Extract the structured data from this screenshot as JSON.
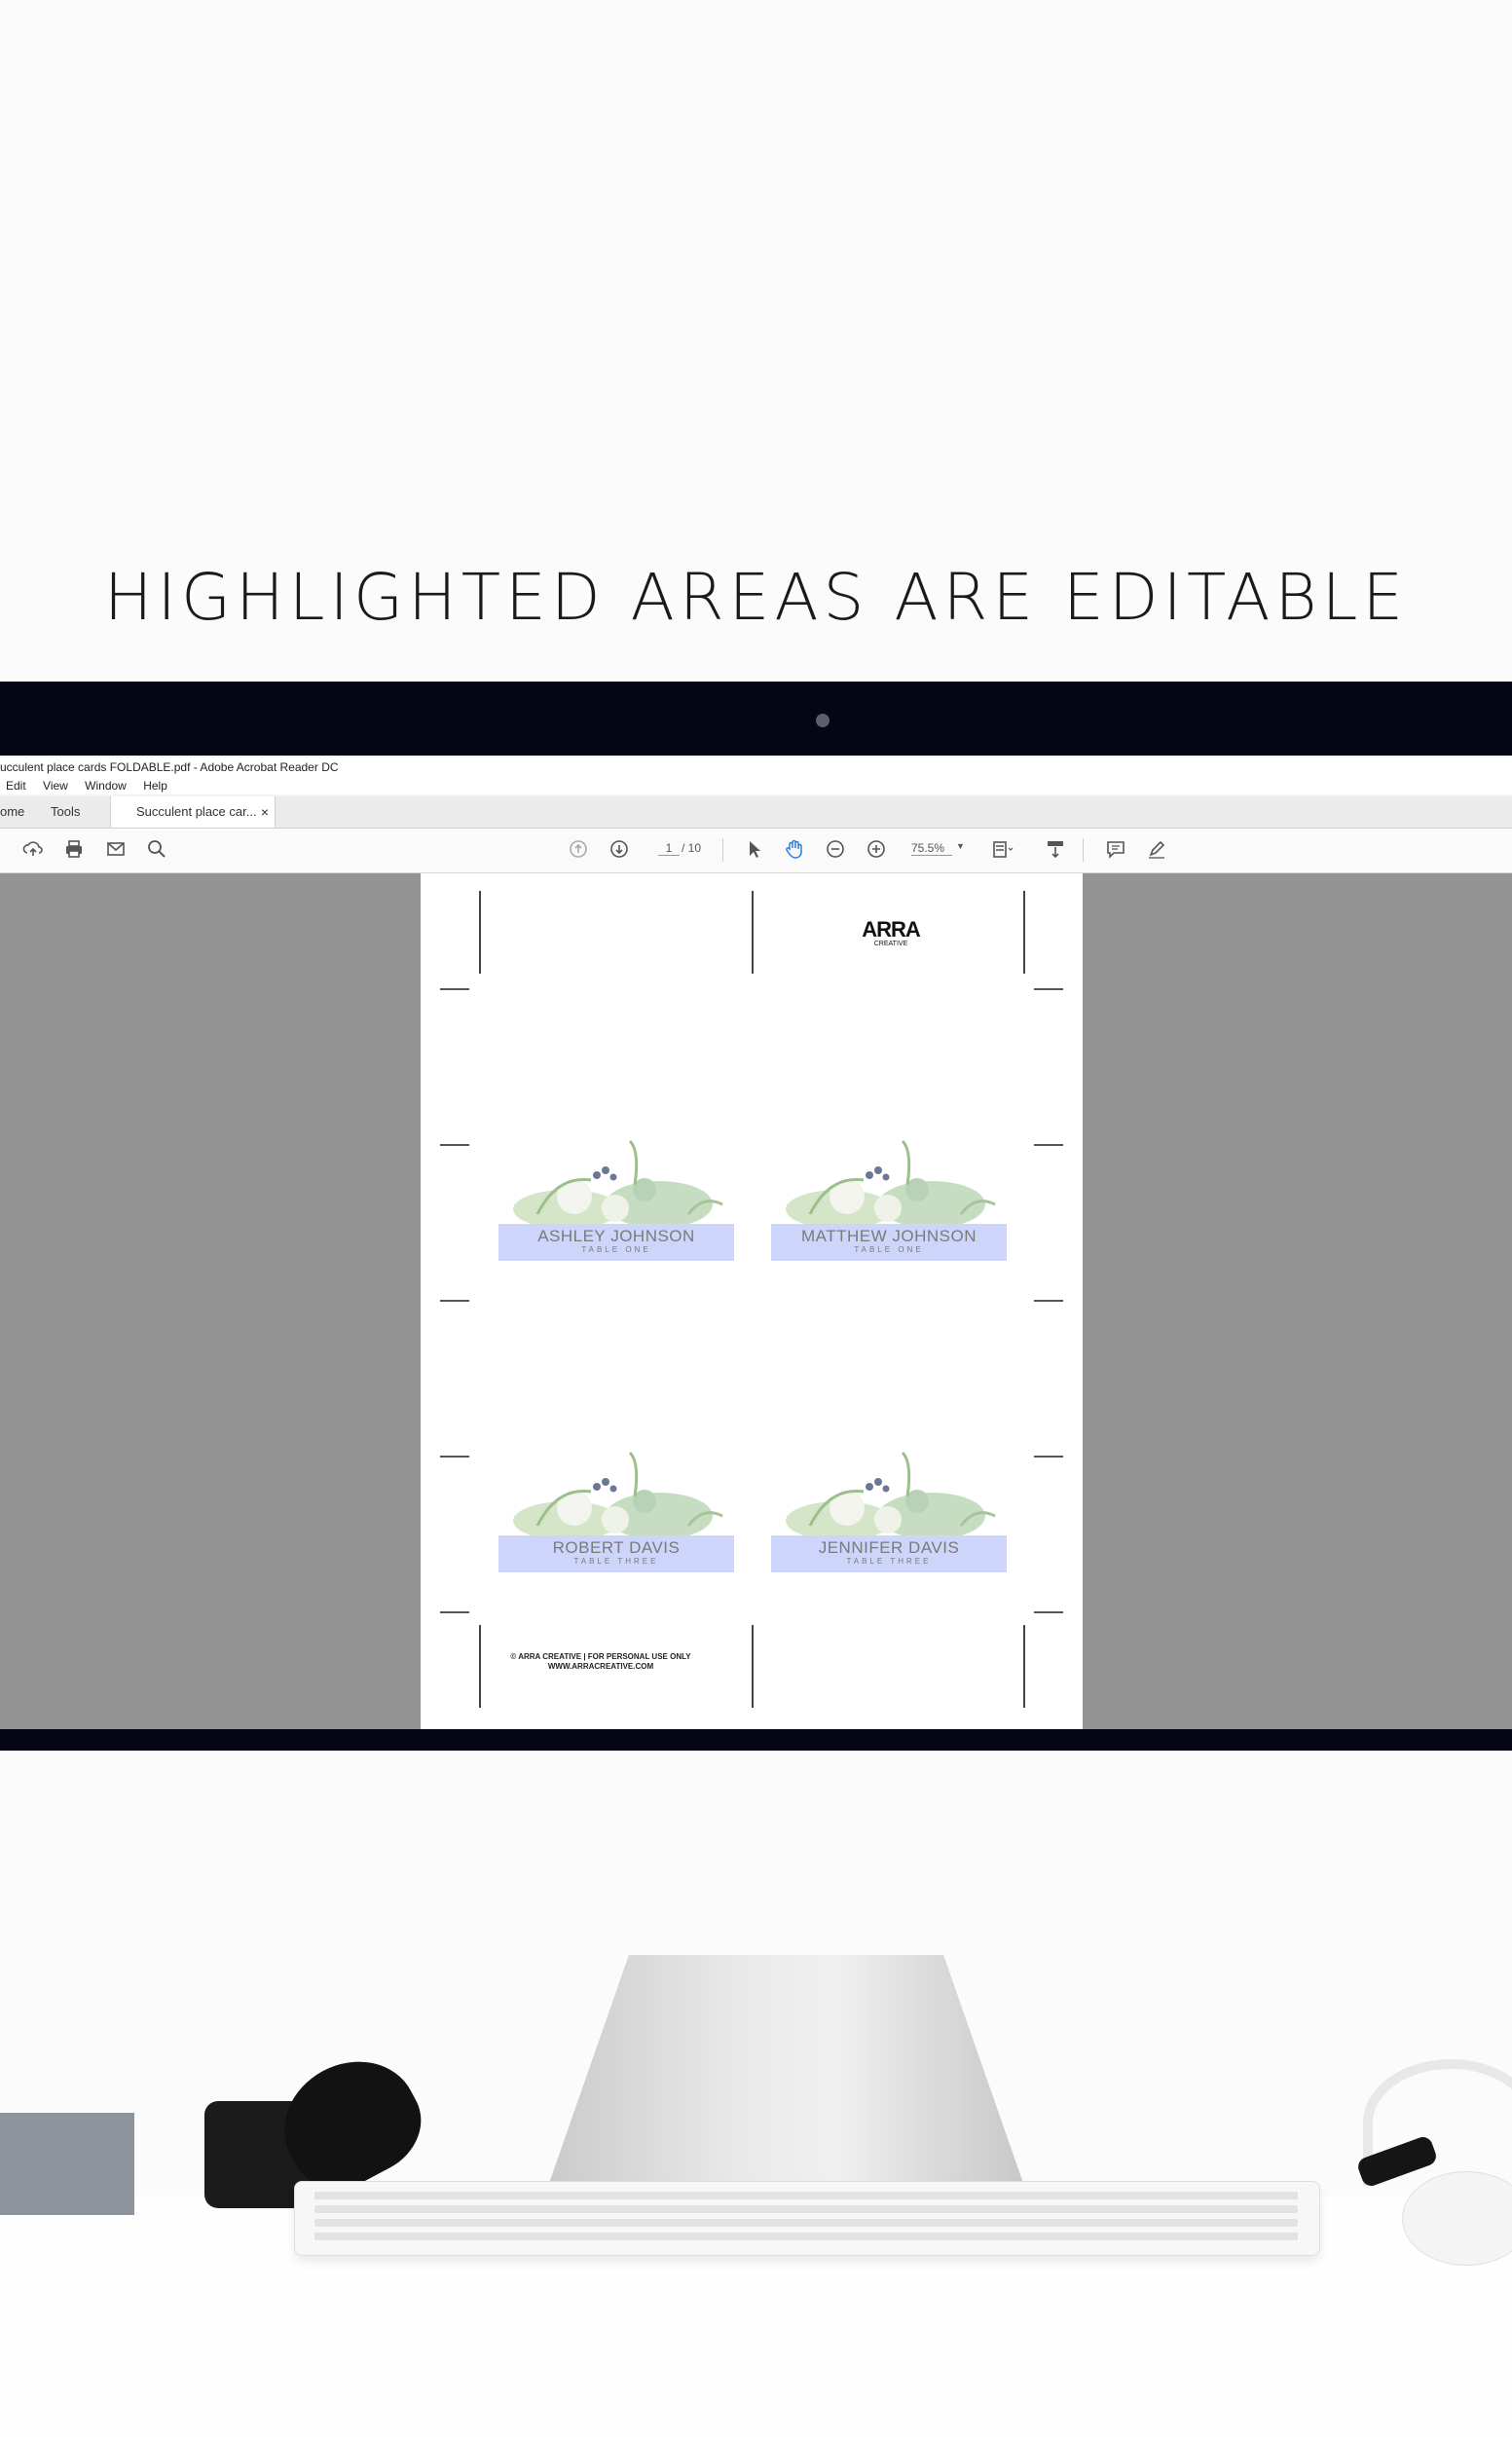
{
  "headline": "HIGHLIGHTED AREAS ARE EDITABLE",
  "app": {
    "title": "ucculent place cards FOLDABLE.pdf - Adobe Acrobat Reader DC",
    "menu": [
      "Edit",
      "View",
      "Window",
      "Help"
    ],
    "tabs": {
      "home": "ome",
      "tools": "Tools",
      "document": "Succulent place car...",
      "close": "×"
    },
    "toolbar": {
      "page_current": "1",
      "page_total": "/ 10",
      "zoom": "75.5%"
    }
  },
  "document": {
    "logo_main": "ARRA",
    "logo_sub": "CREATIVE",
    "cards": [
      {
        "name": "ASHLEY JOHNSON",
        "table": "TABLE ONE"
      },
      {
        "name": "MATTHEW JOHNSON",
        "table": "TABLE ONE"
      },
      {
        "name": "ROBERT DAVIS",
        "table": "TABLE THREE"
      },
      {
        "name": "JENNIFER DAVIS",
        "table": "TABLE THREE"
      }
    ],
    "footer_line1": "© ARRA CREATIVE | FOR PERSONAL USE ONLY",
    "footer_line2": "WWW.ARRACREATIVE.COM"
  },
  "colors": {
    "editable_highlight": "#cdd5fb",
    "bezel": "#040615",
    "viewer_background": "#949494"
  }
}
